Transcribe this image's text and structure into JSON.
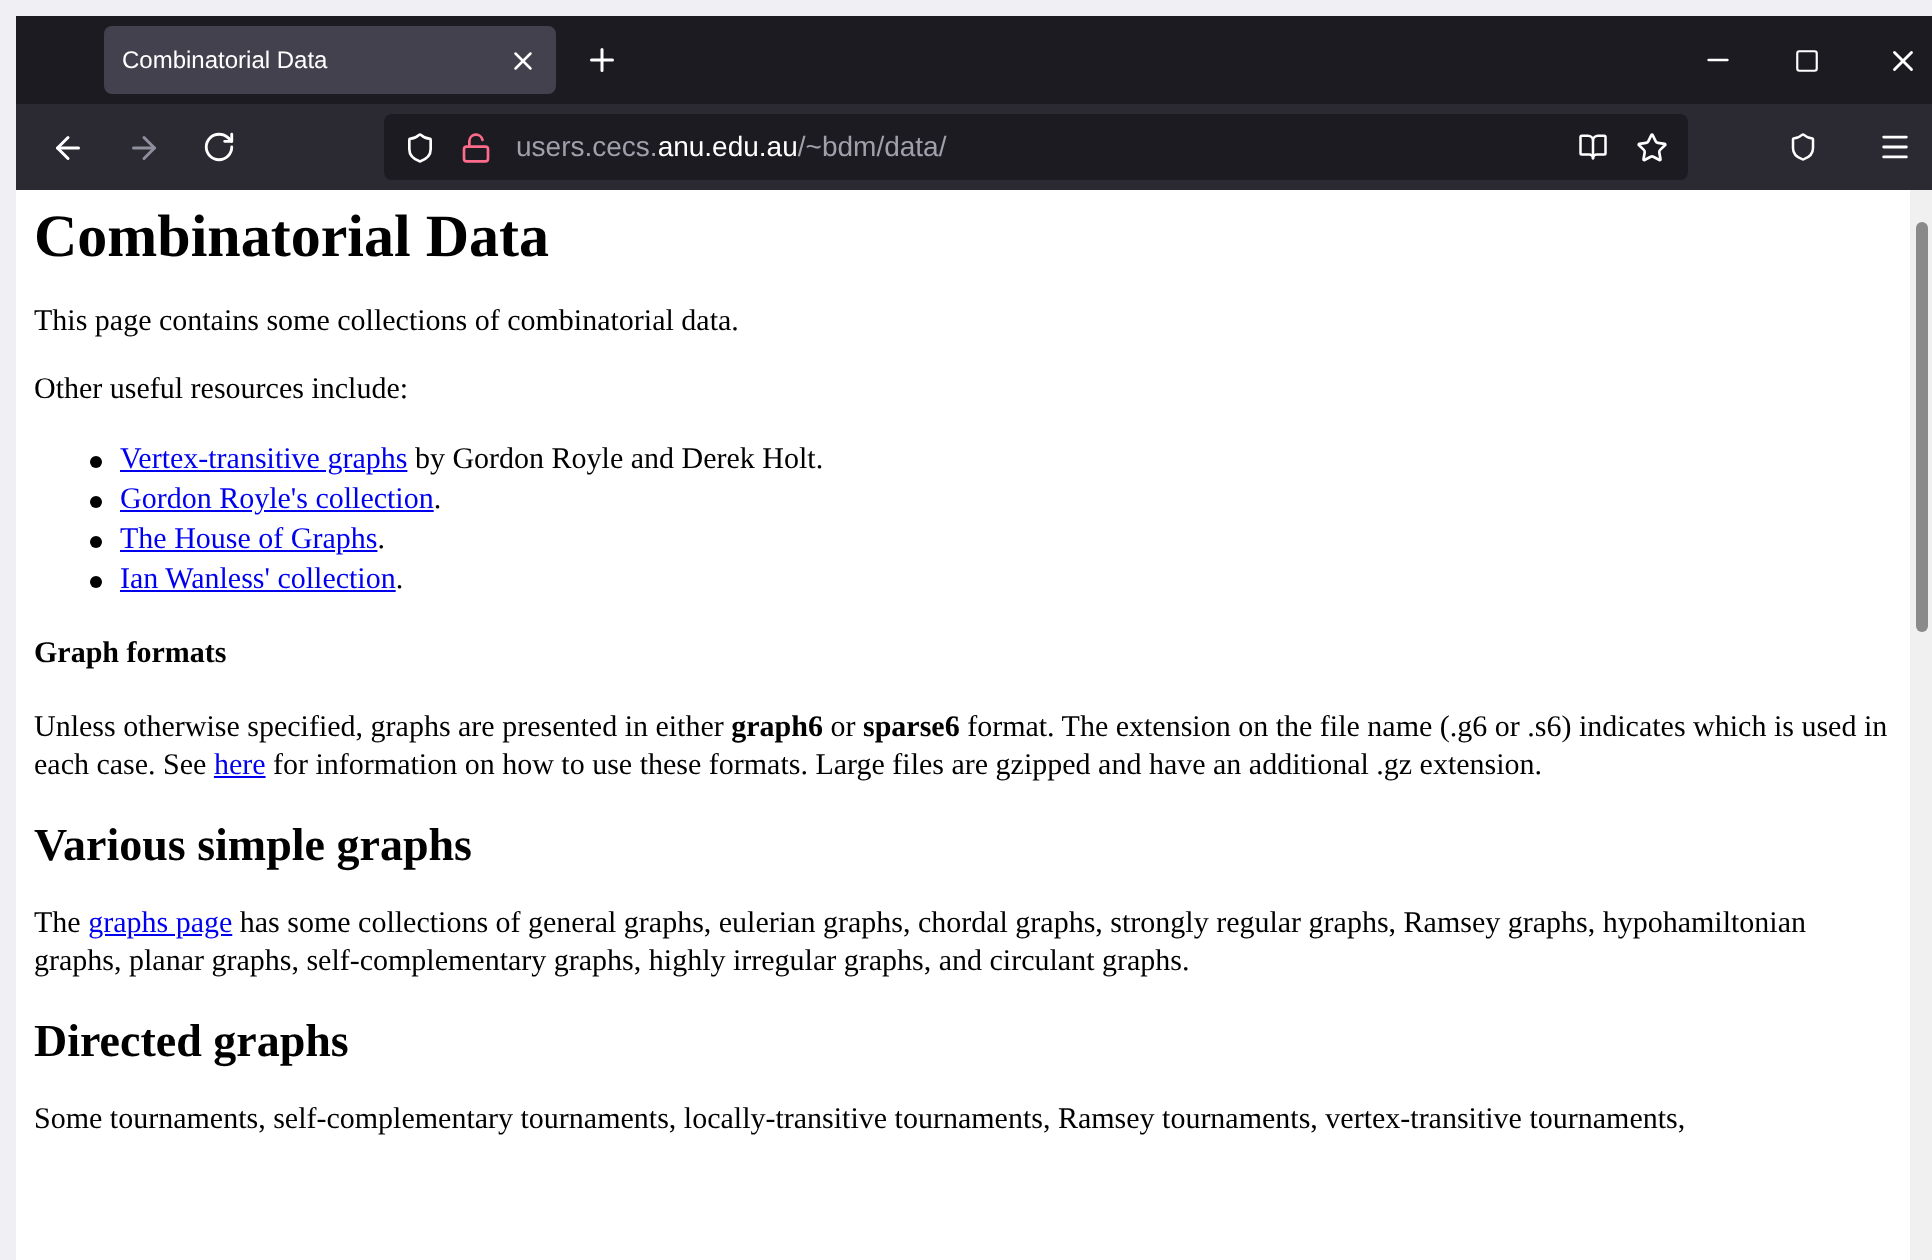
{
  "tab": {
    "title": "Combinatorial Data",
    "selected": true
  },
  "url": {
    "prefix": "users.cecs.",
    "domain": "anu.edu.au",
    "path": "/~bdm/data/"
  },
  "page": {
    "title": "Combinatorial Data",
    "blocks": [
      {
        "kind": "paragraph",
        "parts": [
          {
            "kind": "text",
            "text": "This page contains some collections of combinatorial data."
          }
        ]
      },
      {
        "kind": "paragraph",
        "parts": [
          {
            "kind": "text",
            "text": "Other useful resources include:"
          }
        ]
      },
      {
        "kind": "list",
        "items": [
          {
            "parts": [
              {
                "kind": "link",
                "text": "Vertex-transitive graphs"
              },
              {
                "kind": "text",
                "text": " by Gordon Royle and Derek Holt."
              }
            ]
          },
          {
            "parts": [
              {
                "kind": "link",
                "text": "Gordon Royle's collection"
              },
              {
                "kind": "text",
                "text": "."
              }
            ]
          },
          {
            "parts": [
              {
                "kind": "link",
                "text": "The House of Graphs"
              },
              {
                "kind": "text",
                "text": "."
              }
            ]
          },
          {
            "parts": [
              {
                "kind": "link",
                "text": "Ian Wanless' collection"
              },
              {
                "kind": "text",
                "text": "."
              }
            ]
          }
        ]
      },
      {
        "kind": "subheading",
        "text": "Graph formats"
      },
      {
        "kind": "paragraph",
        "parts": [
          {
            "kind": "text",
            "text": "Unless otherwise specified, graphs are presented in either **graph6** or **sparse6** format. The extension on the file name (.g6 or .s6) indicates which is used in each case. See "
          },
          {
            "kind": "link",
            "text": "here"
          },
          {
            "kind": "text",
            "text": " for information on how to use these formats. Large files are gzipped and have an additional .gz extension."
          }
        ]
      },
      {
        "kind": "heading",
        "text": "Various simple graphs"
      },
      {
        "kind": "paragraph",
        "parts": [
          {
            "kind": "text",
            "text": "The "
          },
          {
            "kind": "link",
            "text": "graphs page"
          },
          {
            "kind": "text",
            "text": " has some collections of general graphs, eulerian graphs, chordal graphs, strongly regular graphs, Ramsey graphs, hypohamiltonian graphs, planar graphs, self-complementary graphs, highly irregular graphs, and circulant graphs."
          }
        ]
      },
      {
        "kind": "heading",
        "text": "Directed graphs"
      },
      {
        "kind": "paragraph",
        "parts": [
          {
            "kind": "text",
            "text": "Some tournaments, self-complementary tournaments, locally-transitive tournaments, Ramsey tournaments, vertex-transitive tournaments,"
          }
        ]
      }
    ]
  }
}
